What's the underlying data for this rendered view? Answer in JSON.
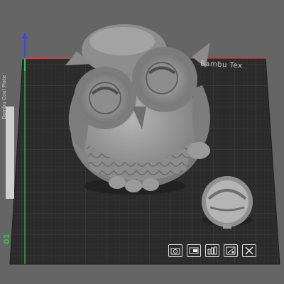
{
  "viewport": {
    "plate_label": "Bambu Tex",
    "plate_number": "01",
    "side_label": "Bambu Cool Plate",
    "colors": {
      "background": "#656565",
      "plate": "#2b2b2b",
      "grid": "#3b3b3b",
      "x_axis": "#e53935",
      "y_axis": "#35c24e",
      "z_axis": "#3b46e0",
      "model": "#9a9a9a"
    }
  },
  "objects": [
    {
      "name": "owl-model"
    },
    {
      "name": "round-lid-model"
    }
  ],
  "toolbar": {
    "buttons": [
      {
        "name": "orient-camera-button",
        "icon": "camera-icon"
      },
      {
        "name": "layers-button",
        "icon": "slice-icon"
      },
      {
        "name": "arrange-button",
        "icon": "arrange-icon"
      },
      {
        "name": "auto-orient-button",
        "icon": "orient-icon"
      },
      {
        "name": "close-plate-button",
        "icon": "close-icon"
      }
    ]
  }
}
